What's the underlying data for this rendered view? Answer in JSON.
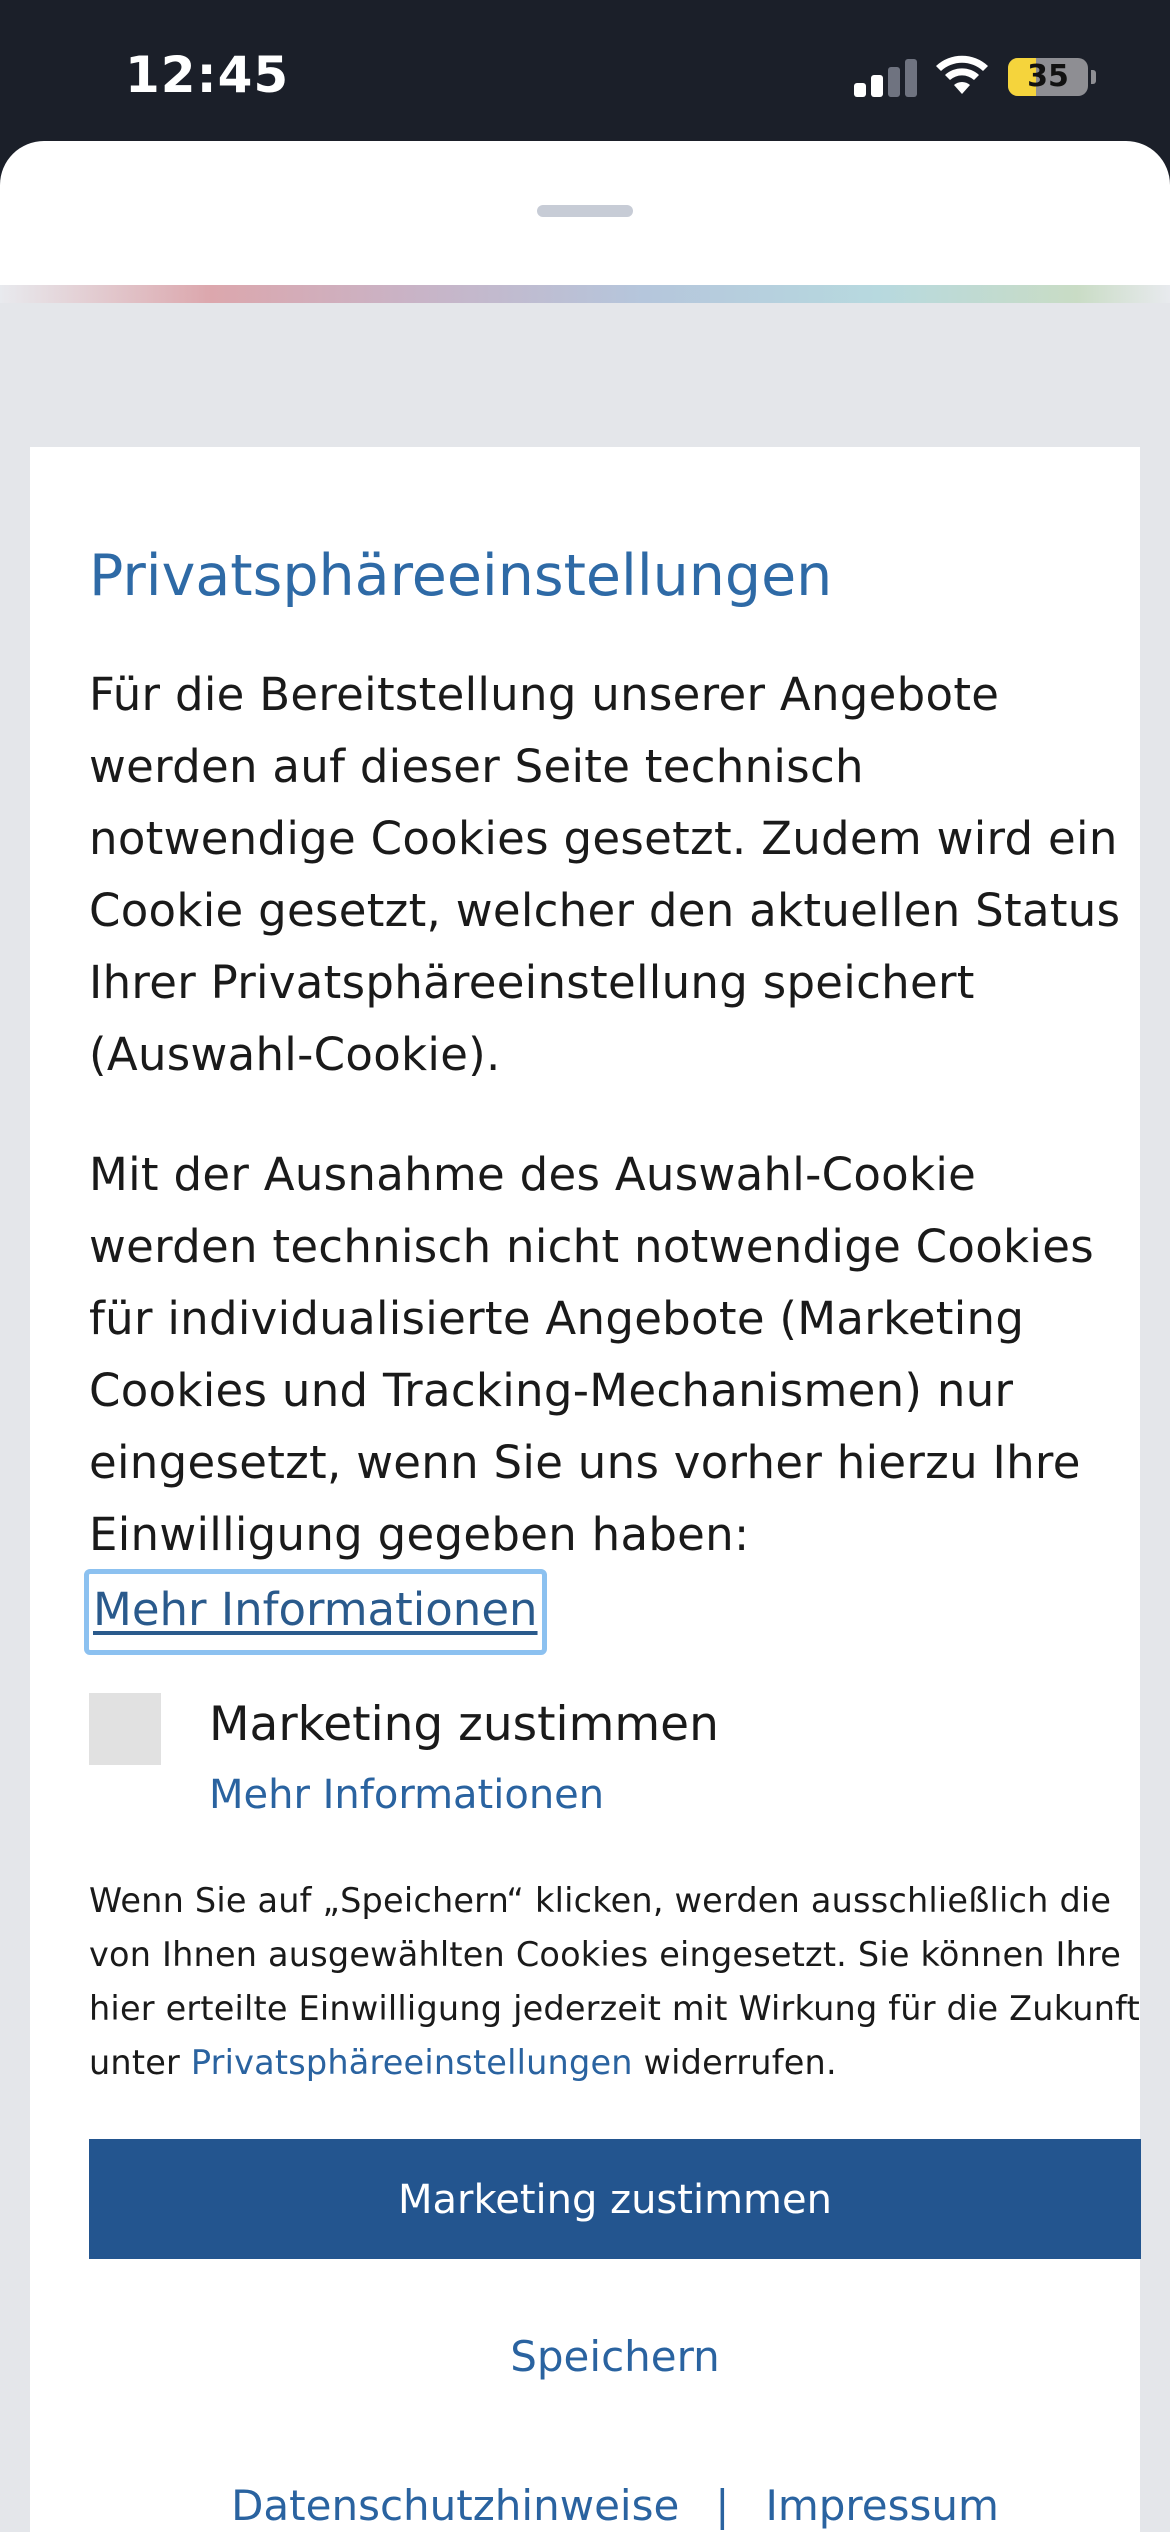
{
  "status_bar": {
    "time": "12:45",
    "battery_percent": "35",
    "battery_level": 0.35,
    "signal_bars_active": 2,
    "signal_bars_total": 4
  },
  "modal": {
    "title": "Privatsphäreeinstellungen",
    "paragraph1": "Für die Bereitstellung unserer Angebote werden auf dieser Seite technisch notwendige Cookies gesetzt. Zudem wird ein Cookie gesetzt, welcher den aktuellen Status Ihrer Privatsphäreeinstellung speichert (Auswahl-Cookie).",
    "paragraph2": "Mit der Ausnahme des Auswahl-Cookie werden technisch nicht notwendige Cookies für individualisierte Angebote (Marketing Cookies und Tracking-Mechanismen) nur eingesetzt, wenn Sie uns vorher hierzu Ihre Einwilligung gegeben haben:",
    "more_info_link": "Mehr Informationen",
    "marketing_option": {
      "label": "Marketing zustimmen",
      "checked": false,
      "more_info": "Mehr Informationen"
    },
    "note": {
      "before_link": "Wenn Sie auf „Speichern“ klicken, werden ausschließlich die von Ihnen ausgewählten Cookies eingesetzt. Sie können Ihre hier erteilte Einwilligung jederzeit mit Wirkung für die Zukunft unter ",
      "link": "Privatsphäreeinstellungen",
      "after_link": " widerrufen."
    },
    "primary_button": "Marketing zustimmen",
    "save_button": "Speichern",
    "footer": {
      "privacy": "Datenschutzhinweise",
      "separator": "|",
      "imprint": "Impressum"
    }
  },
  "colors": {
    "brand_blue": "#23558f",
    "link_blue": "#2a63a0",
    "title_blue": "#2e6aa6",
    "focus_ring": "#8cc1f0",
    "status_bar_bg": "#1b1f29",
    "battery_fill": "#f5d43c"
  }
}
